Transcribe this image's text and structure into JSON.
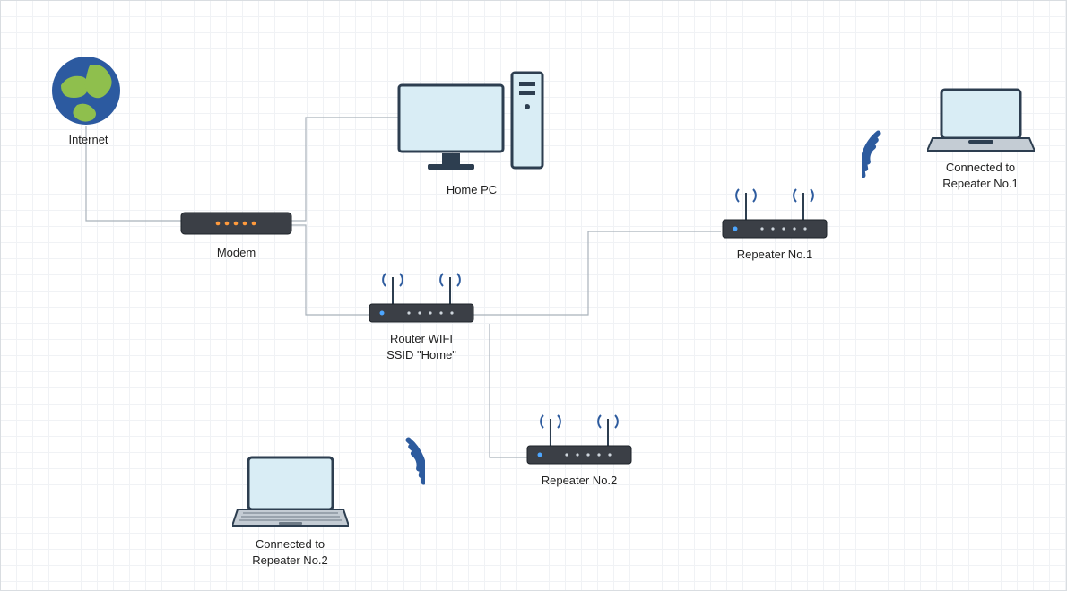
{
  "diagram": {
    "type": "network-topology",
    "nodes": {
      "internet": {
        "label": "Internet"
      },
      "modem": {
        "label": "Modem"
      },
      "home_pc": {
        "label": "Home PC"
      },
      "router": {
        "label": "Router WIFI\nSSID \"Home\""
      },
      "repeater1": {
        "label": "Repeater No.1"
      },
      "repeater2": {
        "label": "Repeater No.2"
      },
      "laptop_r1": {
        "label": "Connected to\nRepeater No.1"
      },
      "laptop_r2": {
        "label": "Connected to\nRepeater No.2"
      }
    },
    "edges": [
      {
        "from": "internet",
        "to": "modem",
        "kind": "wired"
      },
      {
        "from": "modem",
        "to": "home_pc",
        "kind": "wired"
      },
      {
        "from": "modem",
        "to": "router",
        "kind": "wired"
      },
      {
        "from": "router",
        "to": "repeater1",
        "kind": "wired"
      },
      {
        "from": "router",
        "to": "repeater2",
        "kind": "wired"
      },
      {
        "from": "repeater1",
        "to": "laptop_r1",
        "kind": "wireless"
      },
      {
        "from": "repeater2",
        "to": "laptop_r2",
        "kind": "wireless"
      }
    ]
  }
}
